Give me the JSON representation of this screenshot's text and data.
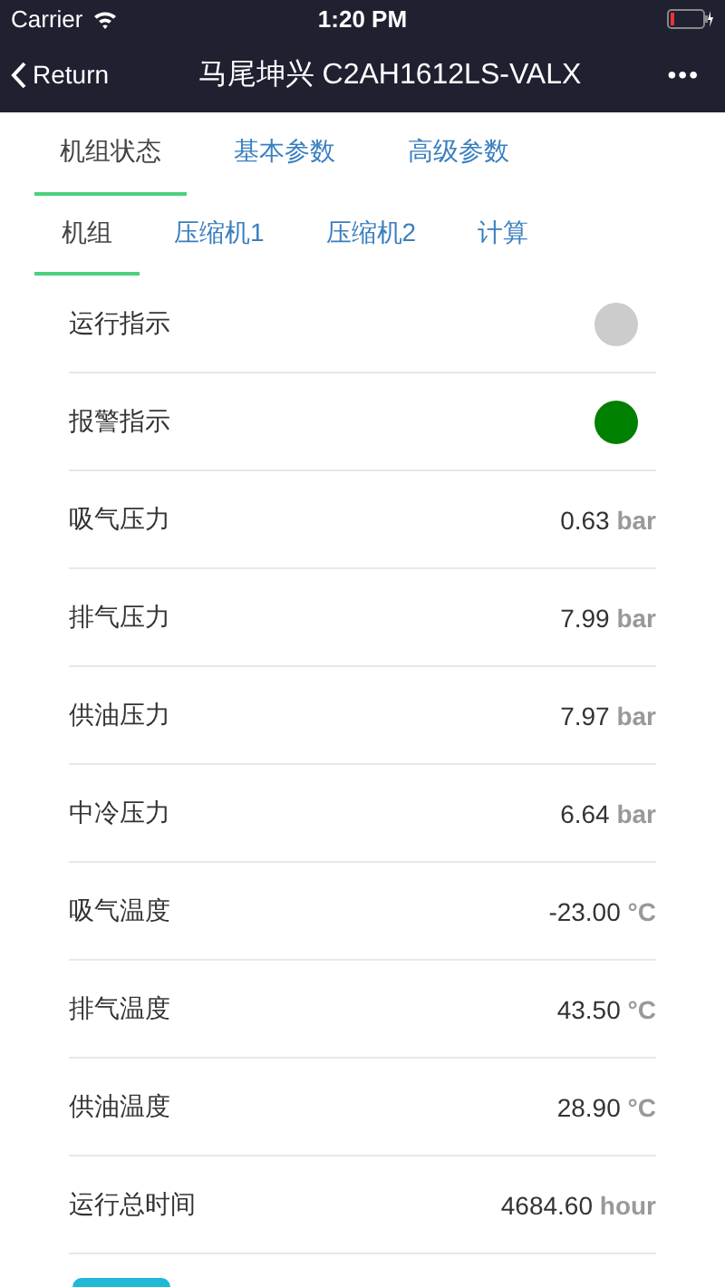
{
  "status_bar": {
    "carrier": "Carrier",
    "time": "1:20 PM"
  },
  "nav_bar": {
    "back": "Return",
    "title": "马尾坤兴 C2AH1612LS-VALX",
    "more": "•••"
  },
  "tabs": [
    {
      "label": "机组状态",
      "selected": true
    },
    {
      "label": "基本参数",
      "selected": false
    },
    {
      "label": "高级参数",
      "selected": false
    }
  ],
  "sub_tabs": [
    {
      "label": "机组",
      "selected": true
    },
    {
      "label": "压缩机1",
      "selected": false
    },
    {
      "label": "压缩机2",
      "selected": false
    },
    {
      "label": "计算",
      "selected": false
    }
  ],
  "rows": [
    {
      "kind": "indicator",
      "label": "运行指示",
      "color": "#cccccc"
    },
    {
      "kind": "indicator",
      "label": "报警指示",
      "color": "#008000"
    },
    {
      "kind": "value",
      "label": "吸气压力",
      "value": "0.63",
      "unit": "bar"
    },
    {
      "kind": "value",
      "label": "排气压力",
      "value": "7.99",
      "unit": "bar"
    },
    {
      "kind": "value",
      "label": "供油压力",
      "value": "7.97",
      "unit": "bar"
    },
    {
      "kind": "value",
      "label": "中冷压力",
      "value": "6.64",
      "unit": "bar"
    },
    {
      "kind": "value",
      "label": "吸气温度",
      "value": "-23.00",
      "unit": "°C"
    },
    {
      "kind": "value",
      "label": "排气温度",
      "value": "43.50",
      "unit": "°C"
    },
    {
      "kind": "value",
      "label": "供油温度",
      "value": "28.90",
      "unit": "°C"
    },
    {
      "kind": "value",
      "label": "运行总时间",
      "value": "4684.60",
      "unit": "hour"
    }
  ],
  "bottom_button": {
    "kind": "button"
  }
}
